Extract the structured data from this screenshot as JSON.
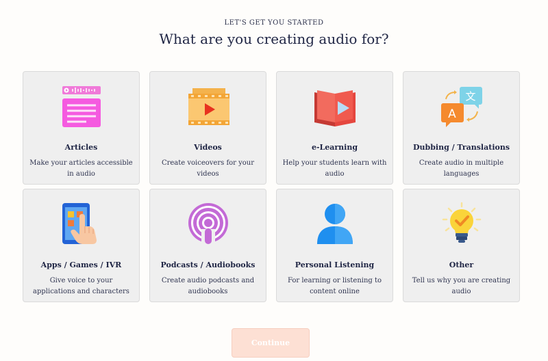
{
  "header": {
    "eyebrow": "LET'S GET YOU STARTED",
    "title": "What are you creating audio for?"
  },
  "cards": [
    {
      "title": "Articles",
      "desc": "Make your articles accessible in audio",
      "icon": "article-icon"
    },
    {
      "title": "Videos",
      "desc": "Create voiceovers for your videos",
      "icon": "video-icon"
    },
    {
      "title": "e-Learning",
      "desc": "Help your students learn with audio",
      "icon": "book-icon"
    },
    {
      "title": "Dubbing / Translations",
      "desc": "Create audio in multiple languages",
      "icon": "translate-icon"
    },
    {
      "title": "Apps / Games / IVR",
      "desc": "Give voice to your applications and characters",
      "icon": "mobile-tap-icon"
    },
    {
      "title": "Podcasts / Audiobooks",
      "desc": "Create audio podcasts and audiobooks",
      "icon": "podcast-icon"
    },
    {
      "title": "Personal Listening",
      "desc": "For learning or listening to content online",
      "icon": "person-icon"
    },
    {
      "title": "Other",
      "desc": "Tell us why you are creating audio",
      "icon": "lightbulb-icon"
    }
  ],
  "footer": {
    "continue_label": "Continue",
    "continue_enabled": false,
    "continue_color": "#fde0d4"
  }
}
